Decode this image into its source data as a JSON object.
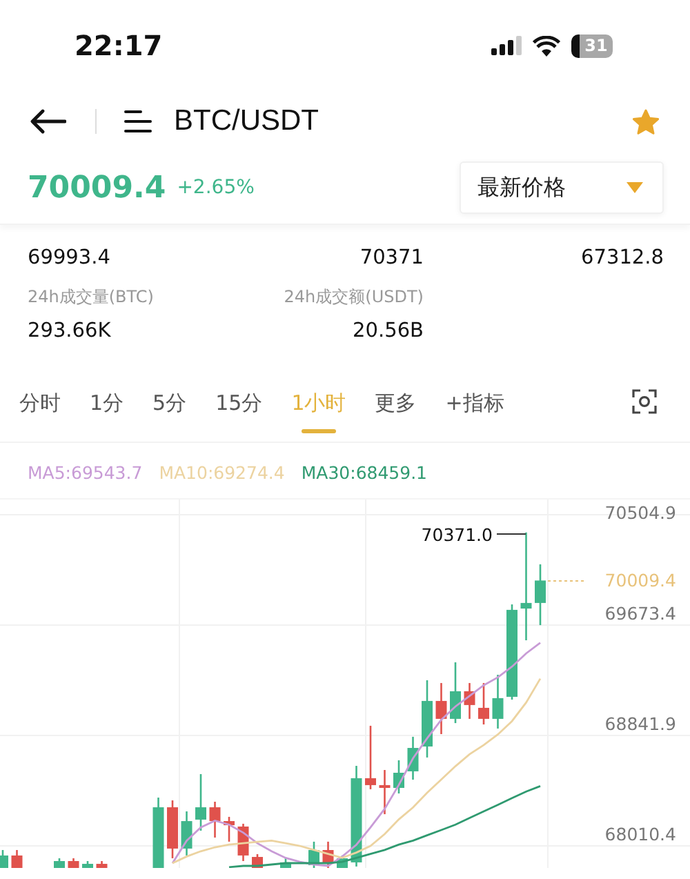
{
  "status_bar": {
    "time": "22:17",
    "battery": "31"
  },
  "header": {
    "title": "BTC/USDT",
    "favorite": true
  },
  "price": {
    "last": "70009.4",
    "change": "+2.65%",
    "selector": "最新价格"
  },
  "stats": [
    {
      "value": "69993.4"
    },
    {
      "value": "70371"
    },
    {
      "value": "67312.8"
    },
    {
      "label": "24h成交量(BTC)",
      "value": "293.66K"
    },
    {
      "label": "24h成交额(USDT)",
      "value": "20.56B"
    }
  ],
  "tabs": [
    {
      "label": "分时",
      "selected": false
    },
    {
      "label": "1分",
      "selected": false
    },
    {
      "label": "5分",
      "selected": false
    },
    {
      "label": "15分",
      "selected": false
    },
    {
      "label": "1小时",
      "selected": true
    },
    {
      "label": "更多",
      "selected": false
    },
    {
      "label": "+指标",
      "selected": false
    }
  ],
  "chart": {
    "chart_data": {
      "type": "candlestick",
      "grid": true,
      "ylim": [
        67844,
        70619
      ],
      "yticks": [
        70504.9,
        69673.4,
        68841.9,
        68010.4
      ],
      "ohlc": [
        [
          67813,
          67979,
          67813,
          67938
        ],
        [
          67938,
          67979,
          67813,
          67813
        ],
        null,
        null,
        [
          67813,
          67917,
          67813,
          67896
        ],
        [
          67896,
          67917,
          67813,
          67813
        ],
        [
          67813,
          67896,
          67813,
          67875
        ],
        [
          67875,
          67896,
          67813,
          67813
        ],
        null,
        null,
        null,
        [
          67813,
          68374,
          67813,
          68301
        ],
        [
          68301,
          68353,
          67917,
          67990
        ],
        [
          67990,
          68270,
          67938,
          68197
        ],
        [
          68208,
          68551,
          68125,
          68301
        ],
        [
          68301,
          68343,
          68073,
          68197
        ],
        [
          68197,
          68229,
          68042,
          68166
        ],
        [
          68156,
          68177,
          67896,
          67938
        ],
        [
          67927,
          67948,
          67813,
          67813
        ],
        null,
        [
          67813,
          67917,
          67813,
          67886
        ],
        null,
        [
          67865,
          68042,
          67834,
          67979
        ],
        [
          67979,
          68042,
          67834,
          67875
        ],
        [
          67813,
          67938,
          67813,
          67917
        ],
        [
          67886,
          68613,
          67855,
          68520
        ],
        [
          68520,
          68915,
          68437,
          68468
        ],
        [
          68468,
          68582,
          68249,
          68447
        ],
        [
          68447,
          68655,
          68405,
          68561
        ],
        [
          68572,
          68832,
          68509,
          68748
        ],
        [
          68759,
          69258,
          68676,
          69102
        ],
        [
          69102,
          69237,
          68852,
          68967
        ],
        [
          68967,
          69393,
          68935,
          69175
        ],
        [
          69175,
          69237,
          68967,
          69071
        ],
        [
          69050,
          69237,
          68925,
          68967
        ],
        [
          68967,
          69299,
          68894,
          69123
        ],
        [
          69133,
          69829,
          69112,
          69788
        ],
        [
          69798,
          70371,
          69559,
          69840
        ],
        [
          69840,
          70131,
          69673,
          70009
        ]
      ],
      "series": [
        {
          "name": "MA5:69543.7",
          "type": "line",
          "color": "#c89bd6",
          "values": [
            null,
            null,
            null,
            null,
            null,
            null,
            null,
            null,
            null,
            null,
            null,
            null,
            67880,
            68050,
            68150,
            68200,
            68170,
            68110,
            68030,
            67970,
            67920,
            67890,
            67870,
            67860,
            67930,
            68020,
            68150,
            68290,
            68470,
            68670,
            68820,
            68960,
            69060,
            69140,
            69220,
            69280,
            69360,
            69460,
            69540
          ]
        },
        {
          "name": "MA10:69274.4",
          "type": "line",
          "color": "#ecd3a0",
          "values": [
            null,
            null,
            null,
            null,
            null,
            null,
            null,
            null,
            null,
            null,
            null,
            null,
            67880,
            67930,
            67970,
            68000,
            68020,
            68030,
            68040,
            68050,
            68030,
            68010,
            67980,
            67950,
            67920,
            67960,
            68010,
            68100,
            68210,
            68300,
            68410,
            68510,
            68610,
            68700,
            68770,
            68850,
            68950,
            69090,
            69270
          ]
        },
        {
          "name": "MA30:68459.1",
          "type": "line",
          "color": "#2f9a70",
          "values": [
            null,
            null,
            null,
            null,
            null,
            null,
            null,
            null,
            null,
            null,
            null,
            null,
            null,
            null,
            null,
            null,
            67850,
            67860,
            67860,
            67870,
            67880,
            67880,
            67880,
            67880,
            67890,
            67920,
            67950,
            67980,
            68020,
            68050,
            68090,
            68130,
            68170,
            68220,
            68270,
            68320,
            68370,
            68420,
            68460
          ]
        }
      ]
    },
    "high_marker": "70371.0",
    "current_price": "70009.4"
  }
}
